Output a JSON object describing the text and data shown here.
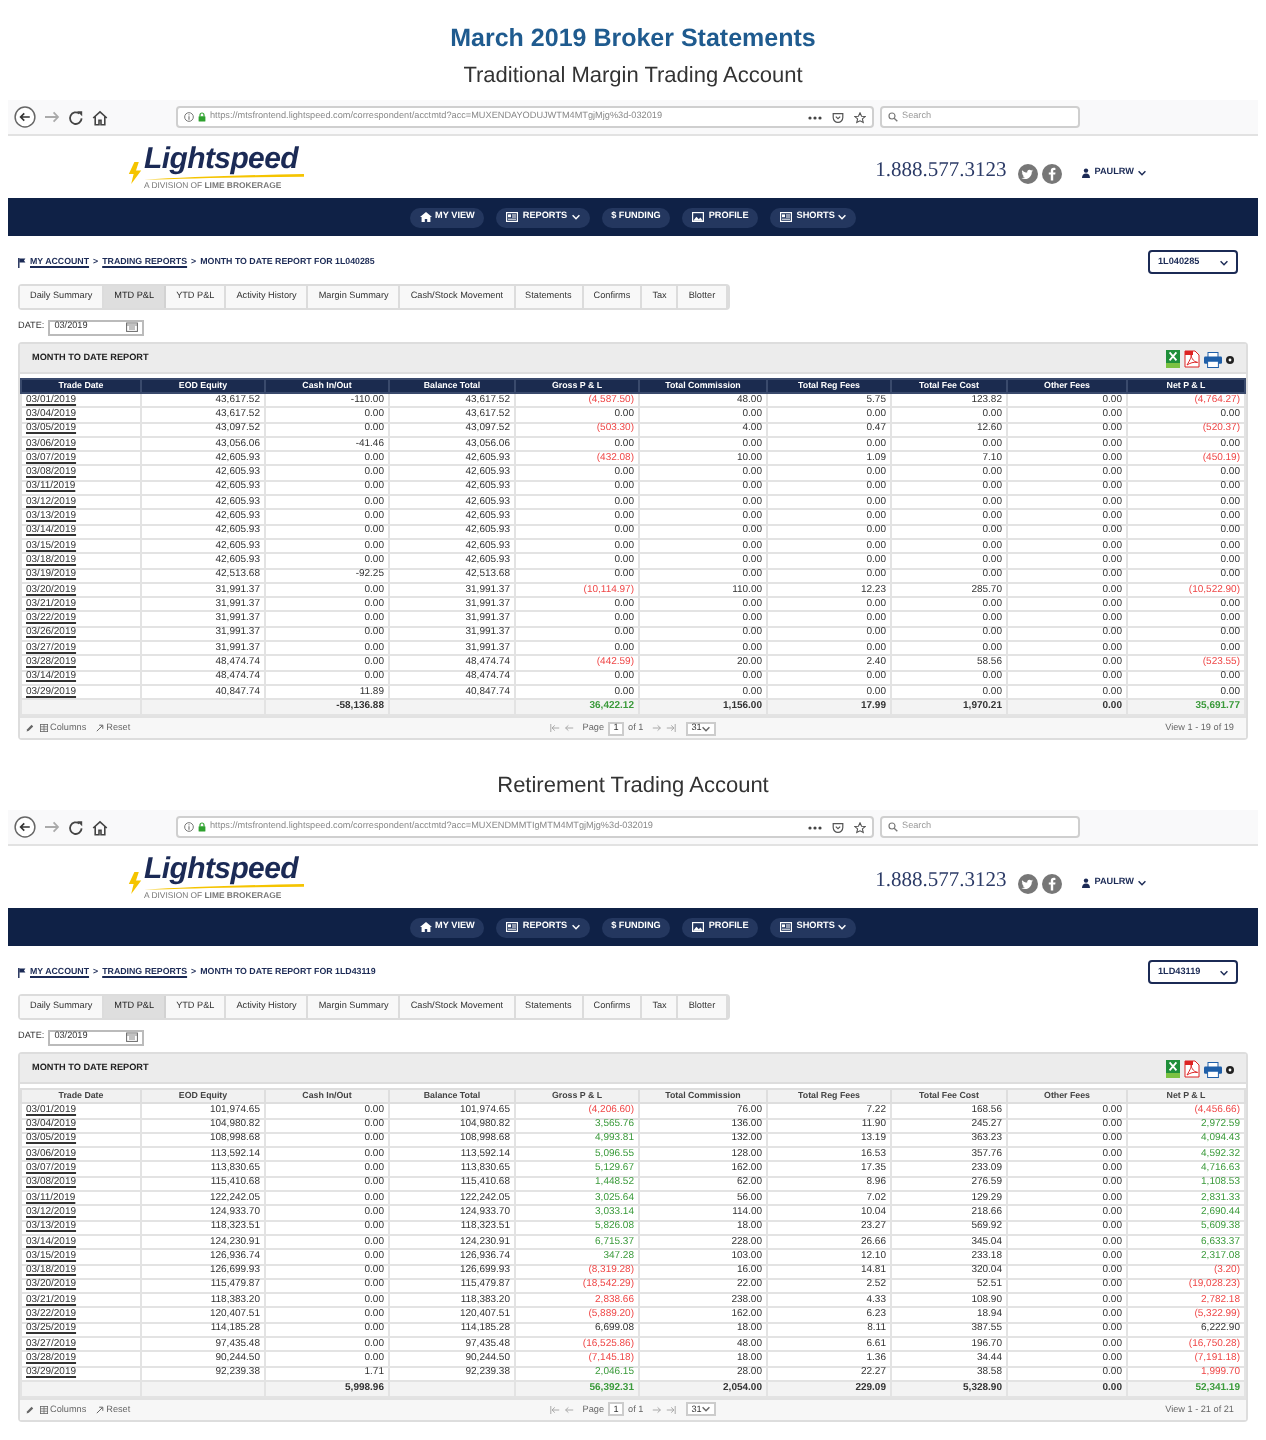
{
  "page": {
    "title": "March 2019 Broker Statements"
  },
  "accounts": [
    {
      "heading": "Traditional Margin Trading Account",
      "browser": {
        "url": "https://mtsfrontend.lightspeed.com/correspondent/acctmtd?acc=MUXENDAYODUJWTM4MTgjMjg%3d-032019",
        "search_placeholder": "Search"
      },
      "site": {
        "logo": "Lightspeed",
        "tagline": "A DIVISION OF **LIME BROKERAGE**",
        "phone": "1.888.577.3123",
        "user": "PAULRW"
      },
      "nav": [
        {
          "label": "MY VIEW",
          "kind": "home",
          "dropdown": false
        },
        {
          "label": "REPORTS",
          "kind": "reports",
          "dropdown": true
        },
        {
          "label": "$ FUNDING",
          "kind": "funding",
          "dropdown": false
        },
        {
          "label": "PROFILE",
          "kind": "profile",
          "dropdown": false
        },
        {
          "label": "SHORTS",
          "kind": "shorts",
          "dropdown": true
        }
      ],
      "breadcrumb": {
        "items": [
          {
            "label": "MY ACCOUNT",
            "link": true
          },
          {
            "separator": ">",
            "label": "TRADING REPORTS",
            "link": true
          },
          {
            "separator": ">",
            "label": "MONTH TO DATE REPORT FOR 1L040285",
            "link": false
          }
        ]
      },
      "account_select": "1L040285",
      "tabs": [
        {
          "label": "Daily Summary",
          "selected": false
        },
        {
          "label": "MTD P&L",
          "selected": true
        },
        {
          "label": "YTD P&L",
          "selected": false
        },
        {
          "label": "Activity History",
          "selected": false
        },
        {
          "label": "Margin Summary",
          "selected": false
        },
        {
          "label": "Cash/Stock Movement",
          "selected": false
        },
        {
          "label": "Statements",
          "selected": false
        },
        {
          "label": "Confirms",
          "selected": false
        },
        {
          "label": "Tax",
          "selected": false
        },
        {
          "label": "Blotter",
          "selected": false
        }
      ],
      "date": {
        "label": "DATE:",
        "value": "03/2019"
      },
      "report": {
        "title": "MONTH TO DATE REPORT",
        "kind": "dark",
        "columns": [
          "Trade Date",
          "EOD Equity",
          "Cash In/Out",
          "Balance Total",
          "Gross P & L",
          "Total Commission",
          "Total Reg Fees",
          "Total Fee Cost",
          "Other Fees",
          "Net P & L"
        ],
        "rows": [
          {
            "date": "03/01/2019",
            "eod_equity": "43,617.52",
            "cash_in_out": "-110.00",
            "balance_total": "43,617.52",
            "gross_pnl": {
              "value": "(4,587.50)",
              "kind": "loss"
            },
            "commission": "48.00",
            "reg_fees": "5.75",
            "fee_cost": "123.82",
            "other_fees": "0.00",
            "net_pnl": {
              "value": "(4,764.27)",
              "kind": "loss"
            }
          },
          {
            "date": "03/04/2019",
            "eod_equity": "43,617.52",
            "cash_in_out": "0.00",
            "balance_total": "43,617.52",
            "gross_pnl": {
              "value": "0.00",
              "kind": "flat"
            },
            "commission": "0.00",
            "reg_fees": "0.00",
            "fee_cost": "0.00",
            "other_fees": "0.00",
            "net_pnl": {
              "value": "0.00",
              "kind": "flat"
            }
          },
          {
            "date": "03/05/2019",
            "eod_equity": "43,097.52",
            "cash_in_out": "0.00",
            "balance_total": "43,097.52",
            "gross_pnl": {
              "value": "(503.30)",
              "kind": "loss"
            },
            "commission": "4.00",
            "reg_fees": "0.47",
            "fee_cost": "12.60",
            "other_fees": "0.00",
            "net_pnl": {
              "value": "(520.37)",
              "kind": "loss"
            }
          },
          {
            "date": "03/06/2019",
            "eod_equity": "43,056.06",
            "cash_in_out": "-41.46",
            "balance_total": "43,056.06",
            "gross_pnl": {
              "value": "0.00",
              "kind": "flat"
            },
            "commission": "0.00",
            "reg_fees": "0.00",
            "fee_cost": "0.00",
            "other_fees": "0.00",
            "net_pnl": {
              "value": "0.00",
              "kind": "flat"
            }
          },
          {
            "date": "03/07/2019",
            "eod_equity": "42,605.93",
            "cash_in_out": "0.00",
            "balance_total": "42,605.93",
            "gross_pnl": {
              "value": "(432.08)",
              "kind": "loss"
            },
            "commission": "10.00",
            "reg_fees": "1.09",
            "fee_cost": "7.10",
            "other_fees": "0.00",
            "net_pnl": {
              "value": "(450.19)",
              "kind": "loss"
            }
          },
          {
            "date": "03/08/2019",
            "eod_equity": "42,605.93",
            "cash_in_out": "0.00",
            "balance_total": "42,605.93",
            "gross_pnl": {
              "value": "0.00",
              "kind": "flat"
            },
            "commission": "0.00",
            "reg_fees": "0.00",
            "fee_cost": "0.00",
            "other_fees": "0.00",
            "net_pnl": {
              "value": "0.00",
              "kind": "flat"
            }
          },
          {
            "date": "03/11/2019",
            "eod_equity": "42,605.93",
            "cash_in_out": "0.00",
            "balance_total": "42,605.93",
            "gross_pnl": {
              "value": "0.00",
              "kind": "flat"
            },
            "commission": "0.00",
            "reg_fees": "0.00",
            "fee_cost": "0.00",
            "other_fees": "0.00",
            "net_pnl": {
              "value": "0.00",
              "kind": "flat"
            }
          },
          {
            "date": "03/12/2019",
            "eod_equity": "42,605.93",
            "cash_in_out": "0.00",
            "balance_total": "42,605.93",
            "gross_pnl": {
              "value": "0.00",
              "kind": "flat"
            },
            "commission": "0.00",
            "reg_fees": "0.00",
            "fee_cost": "0.00",
            "other_fees": "0.00",
            "net_pnl": {
              "value": "0.00",
              "kind": "flat"
            }
          },
          {
            "date": "03/13/2019",
            "eod_equity": "42,605.93",
            "cash_in_out": "0.00",
            "balance_total": "42,605.93",
            "gross_pnl": {
              "value": "0.00",
              "kind": "flat"
            },
            "commission": "0.00",
            "reg_fees": "0.00",
            "fee_cost": "0.00",
            "other_fees": "0.00",
            "net_pnl": {
              "value": "0.00",
              "kind": "flat"
            }
          },
          {
            "date": "03/14/2019",
            "eod_equity": "42,605.93",
            "cash_in_out": "0.00",
            "balance_total": "42,605.93",
            "gross_pnl": {
              "value": "0.00",
              "kind": "flat"
            },
            "commission": "0.00",
            "reg_fees": "0.00",
            "fee_cost": "0.00",
            "other_fees": "0.00",
            "net_pnl": {
              "value": "0.00",
              "kind": "flat"
            }
          },
          {
            "date": "03/15/2019",
            "eod_equity": "42,605.93",
            "cash_in_out": "0.00",
            "balance_total": "42,605.93",
            "gross_pnl": {
              "value": "0.00",
              "kind": "flat"
            },
            "commission": "0.00",
            "reg_fees": "0.00",
            "fee_cost": "0.00",
            "other_fees": "0.00",
            "net_pnl": {
              "value": "0.00",
              "kind": "flat"
            }
          },
          {
            "date": "03/18/2019",
            "eod_equity": "42,605.93",
            "cash_in_out": "0.00",
            "balance_total": "42,605.93",
            "gross_pnl": {
              "value": "0.00",
              "kind": "flat"
            },
            "commission": "0.00",
            "reg_fees": "0.00",
            "fee_cost": "0.00",
            "other_fees": "0.00",
            "net_pnl": {
              "value": "0.00",
              "kind": "flat"
            }
          },
          {
            "date": "03/19/2019",
            "eod_equity": "42,513.68",
            "cash_in_out": "-92.25",
            "balance_total": "42,513.68",
            "gross_pnl": {
              "value": "0.00",
              "kind": "flat"
            },
            "commission": "0.00",
            "reg_fees": "0.00",
            "fee_cost": "0.00",
            "other_fees": "0.00",
            "net_pnl": {
              "value": "0.00",
              "kind": "flat"
            }
          },
          {
            "date": "03/20/2019",
            "eod_equity": "31,991.37",
            "cash_in_out": "0.00",
            "balance_total": "31,991.37",
            "gross_pnl": {
              "value": "(10,114.97)",
              "kind": "loss"
            },
            "commission": "110.00",
            "reg_fees": "12.23",
            "fee_cost": "285.70",
            "other_fees": "0.00",
            "net_pnl": {
              "value": "(10,522.90)",
              "kind": "loss"
            }
          },
          {
            "date": "03/21/2019",
            "eod_equity": "31,991.37",
            "cash_in_out": "0.00",
            "balance_total": "31,991.37",
            "gross_pnl": {
              "value": "0.00",
              "kind": "flat"
            },
            "commission": "0.00",
            "reg_fees": "0.00",
            "fee_cost": "0.00",
            "other_fees": "0.00",
            "net_pnl": {
              "value": "0.00",
              "kind": "flat"
            }
          },
          {
            "date": "03/22/2019",
            "eod_equity": "31,991.37",
            "cash_in_out": "0.00",
            "balance_total": "31,991.37",
            "gross_pnl": {
              "value": "0.00",
              "kind": "flat"
            },
            "commission": "0.00",
            "reg_fees": "0.00",
            "fee_cost": "0.00",
            "other_fees": "0.00",
            "net_pnl": {
              "value": "0.00",
              "kind": "flat"
            }
          },
          {
            "date": "03/26/2019",
            "eod_equity": "31,991.37",
            "cash_in_out": "0.00",
            "balance_total": "31,991.37",
            "gross_pnl": {
              "value": "0.00",
              "kind": "flat"
            },
            "commission": "0.00",
            "reg_fees": "0.00",
            "fee_cost": "0.00",
            "other_fees": "0.00",
            "net_pnl": {
              "value": "0.00",
              "kind": "flat"
            }
          },
          {
            "date": "03/27/2019",
            "eod_equity": "31,991.37",
            "cash_in_out": "0.00",
            "balance_total": "31,991.37",
            "gross_pnl": {
              "value": "0.00",
              "kind": "flat"
            },
            "commission": "0.00",
            "reg_fees": "0.00",
            "fee_cost": "0.00",
            "other_fees": "0.00",
            "net_pnl": {
              "value": "0.00",
              "kind": "flat"
            }
          },
          {
            "date": "03/28/2019",
            "eod_equity": "48,474.74",
            "cash_in_out": "0.00",
            "balance_total": "48,474.74",
            "gross_pnl": {
              "value": "(442.59)",
              "kind": "loss"
            },
            "commission": "20.00",
            "reg_fees": "2.40",
            "fee_cost": "58.56",
            "other_fees": "0.00",
            "net_pnl": {
              "value": "(523.55)",
              "kind": "loss"
            }
          },
          {
            "date": "03/14/2019",
            "eod_equity": "48,474.74",
            "cash_in_out": "0.00",
            "balance_total": "48,474.74",
            "gross_pnl": {
              "value": "0.00",
              "kind": "flat"
            },
            "commission": "0.00",
            "reg_fees": "0.00",
            "fee_cost": "0.00",
            "other_fees": "0.00",
            "net_pnl": {
              "value": "0.00",
              "kind": "flat"
            }
          },
          {
            "date": "03/29/2019",
            "eod_equity": "40,847.74",
            "cash_in_out": "11.89",
            "balance_total": "40,847.74",
            "gross_pnl": {
              "value": "0.00",
              "kind": "flat"
            },
            "commission": "0.00",
            "reg_fees": "0.00",
            "fee_cost": "0.00",
            "other_fees": "0.00",
            "net_pnl": {
              "value": "0.00",
              "kind": "flat"
            }
          }
        ],
        "totals": {
          "cash_in_out": "-58,136.88",
          "gross_pnl": {
            "value": "36,422.12",
            "kind": "gain"
          },
          "commission": "1,156.00",
          "reg_fees": "17.99",
          "fee_cost": "1,970.21",
          "other_fees": "0.00",
          "net_pnl": {
            "value": "35,691.77",
            "kind": "gain"
          }
        },
        "footer": {
          "columns": "Columns",
          "reset": "Reset",
          "page_label": "Page",
          "page": "1",
          "page_count": "of 1",
          "page_size": "31",
          "view": "View 1 - 19 of 19"
        }
      }
    },
    {
      "heading": "Retirement Trading Account",
      "browser": {
        "url": "https://mtsfrontend.lightspeed.com/correspondent/acctmtd?acc=MUXENDMMTIgMTM4MTgjMjg%3d-032019",
        "search_placeholder": "Search"
      },
      "site": {
        "logo": "Lightspeed",
        "tagline": "A DIVISION OF **LIME BROKERAGE**",
        "phone": "1.888.577.3123",
        "user": "PAULRW"
      },
      "nav": [
        {
          "label": "MY VIEW",
          "kind": "home",
          "dropdown": false
        },
        {
          "label": "REPORTS",
          "kind": "reports",
          "dropdown": true
        },
        {
          "label": "$ FUNDING",
          "kind": "funding",
          "dropdown": false
        },
        {
          "label": "PROFILE",
          "kind": "profile",
          "dropdown": false
        },
        {
          "label": "SHORTS",
          "kind": "shorts",
          "dropdown": true
        }
      ],
      "breadcrumb": {
        "items": [
          {
            "label": "MY ACCOUNT",
            "link": true
          },
          {
            "separator": ">",
            "label": "TRADING REPORTS",
            "link": true
          },
          {
            "separator": ">",
            "label": "MONTH TO DATE REPORT FOR 1LD43119",
            "link": false
          }
        ]
      },
      "account_select": "1LD43119",
      "tabs": [
        {
          "label": "Daily Summary",
          "selected": false
        },
        {
          "label": "MTD P&L",
          "selected": true
        },
        {
          "label": "YTD P&L",
          "selected": false
        },
        {
          "label": "Activity History",
          "selected": false
        },
        {
          "label": "Margin Summary",
          "selected": false
        },
        {
          "label": "Cash/Stock Movement",
          "selected": false
        },
        {
          "label": "Statements",
          "selected": false
        },
        {
          "label": "Confirms",
          "selected": false
        },
        {
          "label": "Tax",
          "selected": false
        },
        {
          "label": "Blotter",
          "selected": false
        }
      ],
      "date": {
        "label": "DATE:",
        "value": "03/2019"
      },
      "report": {
        "title": "MONTH TO DATE REPORT",
        "kind": "light",
        "columns": [
          "Trade Date",
          "EOD Equity",
          "Cash In/Out",
          "Balance Total",
          "Gross P & L",
          "Total Commission",
          "Total Reg Fees",
          "Total Fee Cost",
          "Other Fees",
          "Net P & L"
        ],
        "rows": [
          {
            "date": "03/01/2019",
            "eod_equity": "101,974.65",
            "cash_in_out": "0.00",
            "balance_total": "101,974.65",
            "gross_pnl": {
              "value": "(4,206.60)",
              "kind": "loss"
            },
            "commission": "76.00",
            "reg_fees": "7.22",
            "fee_cost": "168.56",
            "other_fees": "0.00",
            "net_pnl": {
              "value": "(4,456.66)",
              "kind": "loss"
            }
          },
          {
            "date": "03/04/2019",
            "eod_equity": "104,980.82",
            "cash_in_out": "0.00",
            "balance_total": "104,980.82",
            "gross_pnl": {
              "value": "3,565.76",
              "kind": "gain"
            },
            "commission": "136.00",
            "reg_fees": "11.90",
            "fee_cost": "245.27",
            "other_fees": "0.00",
            "net_pnl": {
              "value": "2,972.59",
              "kind": "gain"
            }
          },
          {
            "date": "03/05/2019",
            "eod_equity": "108,998.68",
            "cash_in_out": "0.00",
            "balance_total": "108,998.68",
            "gross_pnl": {
              "value": "4,993.81",
              "kind": "gain"
            },
            "commission": "132.00",
            "reg_fees": "13.19",
            "fee_cost": "363.23",
            "other_fees": "0.00",
            "net_pnl": {
              "value": "4,094.43",
              "kind": "gain"
            }
          },
          {
            "date": "03/06/2019",
            "eod_equity": "113,592.14",
            "cash_in_out": "0.00",
            "balance_total": "113,592.14",
            "gross_pnl": {
              "value": "5,096.55",
              "kind": "gain"
            },
            "commission": "128.00",
            "reg_fees": "16.53",
            "fee_cost": "357.76",
            "other_fees": "0.00",
            "net_pnl": {
              "value": "4,592.32",
              "kind": "gain"
            }
          },
          {
            "date": "03/07/2019",
            "eod_equity": "113,830.65",
            "cash_in_out": "0.00",
            "balance_total": "113,830.65",
            "gross_pnl": {
              "value": "5,129.67",
              "kind": "gain"
            },
            "commission": "162.00",
            "reg_fees": "17.35",
            "fee_cost": "233.09",
            "other_fees": "0.00",
            "net_pnl": {
              "value": "4,716.63",
              "kind": "gain"
            }
          },
          {
            "date": "03/08/2019",
            "eod_equity": "115,410.68",
            "cash_in_out": "0.00",
            "balance_total": "115,410.68",
            "gross_pnl": {
              "value": "1,448.52",
              "kind": "gain"
            },
            "commission": "62.00",
            "reg_fees": "8.96",
            "fee_cost": "276.59",
            "other_fees": "0.00",
            "net_pnl": {
              "value": "1,108.53",
              "kind": "gain"
            }
          },
          {
            "date": "03/11/2019",
            "eod_equity": "122,242.05",
            "cash_in_out": "0.00",
            "balance_total": "122,242.05",
            "gross_pnl": {
              "value": "3,025.64",
              "kind": "gain"
            },
            "commission": "56.00",
            "reg_fees": "7.02",
            "fee_cost": "129.29",
            "other_fees": "0.00",
            "net_pnl": {
              "value": "2,831.33",
              "kind": "gain"
            }
          },
          {
            "date": "03/12/2019",
            "eod_equity": "124,933.70",
            "cash_in_out": "0.00",
            "balance_total": "124,933.70",
            "gross_pnl": {
              "value": "3,033.14",
              "kind": "gain"
            },
            "commission": "114.00",
            "reg_fees": "10.04",
            "fee_cost": "218.66",
            "other_fees": "0.00",
            "net_pnl": {
              "value": "2,690.44",
              "kind": "gain"
            }
          },
          {
            "date": "03/13/2019",
            "eod_equity": "118,323.51",
            "cash_in_out": "0.00",
            "balance_total": "118,323.51",
            "gross_pnl": {
              "value": "5,826.08",
              "kind": "gain"
            },
            "commission": "18.00",
            "reg_fees": "23.27",
            "fee_cost": "569.92",
            "other_fees": "0.00",
            "net_pnl": {
              "value": "5,609.38",
              "kind": "gain"
            }
          },
          {
            "date": "03/14/2019",
            "eod_equity": "124,230.91",
            "cash_in_out": "0.00",
            "balance_total": "124,230.91",
            "gross_pnl": {
              "value": "6,715.37",
              "kind": "gain"
            },
            "commission": "228.00",
            "reg_fees": "26.66",
            "fee_cost": "345.04",
            "other_fees": "0.00",
            "net_pnl": {
              "value": "6,633.37",
              "kind": "gain"
            }
          },
          {
            "date": "03/15/2019",
            "eod_equity": "126,936.74",
            "cash_in_out": "0.00",
            "balance_total": "126,936.74",
            "gross_pnl": {
              "value": "347.28",
              "kind": "gain"
            },
            "commission": "103.00",
            "reg_fees": "12.10",
            "fee_cost": "233.18",
            "other_fees": "0.00",
            "net_pnl": {
              "value": "2,317.08",
              "kind": "gain"
            }
          },
          {
            "date": "03/18/2019",
            "eod_equity": "126,699.93",
            "cash_in_out": "0.00",
            "balance_total": "126,699.93",
            "gross_pnl": {
              "value": "(8,319.28)",
              "kind": "loss"
            },
            "commission": "16.00",
            "reg_fees": "14.81",
            "fee_cost": "320.04",
            "other_fees": "0.00",
            "net_pnl": {
              "value": "(3.20)",
              "kind": "loss"
            }
          },
          {
            "date": "03/20/2019",
            "eod_equity": "115,479.87",
            "cash_in_out": "0.00",
            "balance_total": "115,479.87",
            "gross_pnl": {
              "value": "(18,542.29)",
              "kind": "loss"
            },
            "commission": "22.00",
            "reg_fees": "2.52",
            "fee_cost": "52.51",
            "other_fees": "0.00",
            "net_pnl": {
              "value": "(19,028.23)",
              "kind": "loss"
            }
          },
          {
            "date": "03/21/2019",
            "eod_equity": "118,383.20",
            "cash_in_out": "0.00",
            "balance_total": "118,383.20",
            "gross_pnl": {
              "value": "2,838.66",
              "kind": "loss"
            },
            "commission": "238.00",
            "reg_fees": "4.33",
            "fee_cost": "108.90",
            "other_fees": "0.00",
            "net_pnl": {
              "value": "2,782.18",
              "kind": "loss"
            }
          },
          {
            "date": "03/22/2019",
            "eod_equity": "120,407.51",
            "cash_in_out": "0.00",
            "balance_total": "120,407.51",
            "gross_pnl": {
              "value": "(5,889.20)",
              "kind": "loss"
            },
            "commission": "162.00",
            "reg_fees": "6.23",
            "fee_cost": "18.94",
            "other_fees": "0.00",
            "net_pnl": {
              "value": "(5,322.99)",
              "kind": "loss"
            }
          },
          {
            "date": "03/25/2019",
            "eod_equity": "114,185.28",
            "cash_in_out": "0.00",
            "balance_total": "114,185.28",
            "gross_pnl": {
              "value": "6,699.08",
              "kind": "flat"
            },
            "commission": "18.00",
            "reg_fees": "8.11",
            "fee_cost": "387.55",
            "other_fees": "0.00",
            "net_pnl": {
              "value": "6,222.90",
              "kind": "flat"
            }
          },
          {
            "date": "03/27/2019",
            "eod_equity": "97,435.48",
            "cash_in_out": "0.00",
            "balance_total": "97,435.48",
            "gross_pnl": {
              "value": "(16,525.86)",
              "kind": "loss"
            },
            "commission": "48.00",
            "reg_fees": "6.61",
            "fee_cost": "196.70",
            "other_fees": "0.00",
            "net_pnl": {
              "value": "(16,750.28)",
              "kind": "loss"
            }
          },
          {
            "date": "03/28/2019",
            "eod_equity": "90,244.50",
            "cash_in_out": "0.00",
            "balance_total": "90,244.50",
            "gross_pnl": {
              "value": "(7,145.18)",
              "kind": "loss"
            },
            "commission": "18.00",
            "reg_fees": "1.36",
            "fee_cost": "34.44",
            "other_fees": "0.00",
            "net_pnl": {
              "value": "(7,191.18)",
              "kind": "loss"
            }
          },
          {
            "date": "03/29/2019",
            "eod_equity": "92,239.38",
            "cash_in_out": "1.71",
            "balance_total": "92,239.38",
            "gross_pnl": {
              "value": "2,046.15",
              "kind": "gain"
            },
            "commission": "28.00",
            "reg_fees": "22.27",
            "fee_cost": "38.58",
            "other_fees": "0.00",
            "net_pnl": {
              "value": "1,999.70",
              "kind": "loss"
            }
          }
        ],
        "totals": {
          "cash_in_out": "5,998.96",
          "gross_pnl": {
            "value": "56,392.31",
            "kind": "gain"
          },
          "commission": "2,054.00",
          "reg_fees": "229.09",
          "fee_cost": "5,328.90",
          "other_fees": "0.00",
          "net_pnl": {
            "value": "52,341.19",
            "kind": "gain"
          }
        },
        "footer": {
          "columns": "Columns",
          "reset": "Reset",
          "page_label": "Page",
          "page": "1",
          "page_count": "of 1",
          "page_size": "31",
          "view": "View 1 - 21 of 21"
        }
      }
    }
  ]
}
